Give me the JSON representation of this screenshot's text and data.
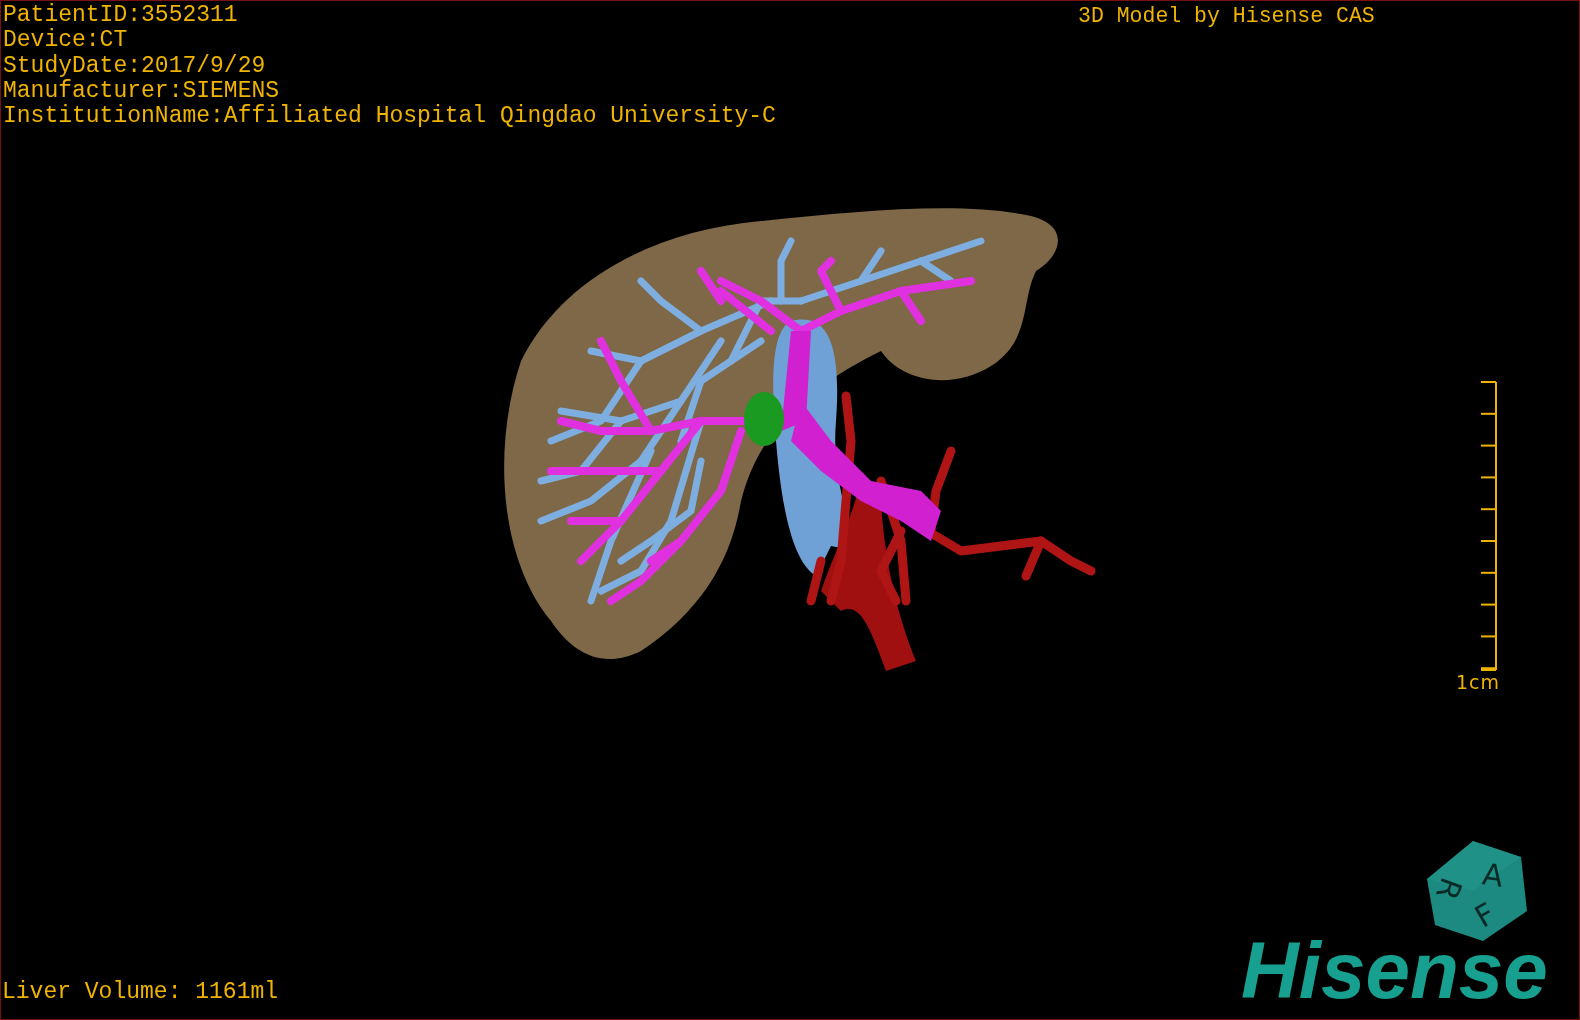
{
  "info_lines": [
    "PatientID:3552311",
    "Device:CT",
    "StudyDate:2017/9/29",
    "Manufacturer:SIEMENS",
    "InstitutionName:Affiliated Hospital Qingdao University-C"
  ],
  "title": "3D Model by Hisense CAS",
  "scale_bar": {
    "label": "1cm"
  },
  "orientation_cube": {
    "faces": [
      "A",
      "F",
      "R"
    ]
  },
  "logo": "Hisense",
  "liver_volume": "Liver Volume: 1161ml"
}
